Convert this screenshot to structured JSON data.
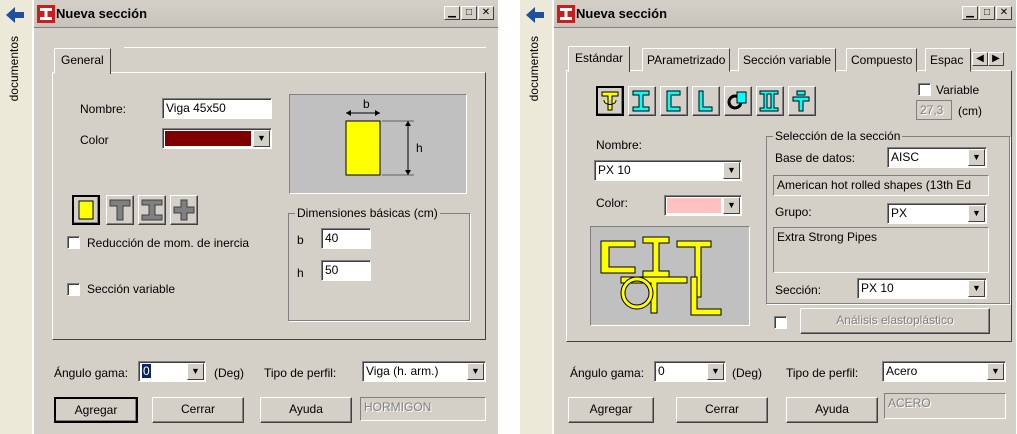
{
  "left": {
    "side_tab": "documentos",
    "window_title": "Nueva sección",
    "tab_general": "General",
    "nombre_label": "Nombre:",
    "nombre_value": "Viga 45x50",
    "color_label": "Color",
    "color_value": "#800000",
    "preview_b": "b",
    "preview_h": "h",
    "reduccion_label": "Reducción de mom. de inercia",
    "seccion_variable_label": "Sección variable",
    "dims_title": "Dimensiones básicas (cm)",
    "b_label": "b",
    "b_value": "40",
    "h_label": "h",
    "h_value": "50",
    "angulo_label": "Ángulo gama:",
    "angulo_value": "0",
    "deg_label": "(Deg)",
    "tipo_label": "Tipo de perfil:",
    "tipo_value": "Viga (h. arm.)",
    "agregar": "Agregar",
    "cerrar": "Cerrar",
    "ayuda": "Ayuda",
    "material": "HORMIGON"
  },
  "right": {
    "side_tab": "documentos",
    "window_title": "Nueva sección",
    "tabs": [
      "Estándar",
      "PArametrizado",
      "Sección variable",
      "Compuesto",
      "Espac"
    ],
    "variable_label": "Variable",
    "variable_value": "27,3",
    "cm_label": "(cm)",
    "nombre_label": "Nombre:",
    "nombre_value": "PX 10",
    "color_label": "Color:",
    "color_value": "#ffc0c0",
    "seleccion_title": "Selección de la sección",
    "base_label": "Base de datos:",
    "base_value": "AISC",
    "base_desc": "American hot rolled shapes (13th Ed",
    "grupo_label": "Grupo:",
    "grupo_value": "PX",
    "grupo_desc": "Extra Strong Pipes",
    "seccion_label": "Sección:",
    "seccion_value": "PX 10",
    "analisis_label": "Análisis elastoplástico",
    "angulo_label": "Ángulo gama:",
    "angulo_value": "0",
    "deg_label": "(Deg)",
    "tipo_label": "Tipo de perfil:",
    "tipo_value": "Acero",
    "agregar": "Agregar",
    "cerrar": "Cerrar",
    "ayuda": "Ayuda",
    "material": "ACERO"
  }
}
